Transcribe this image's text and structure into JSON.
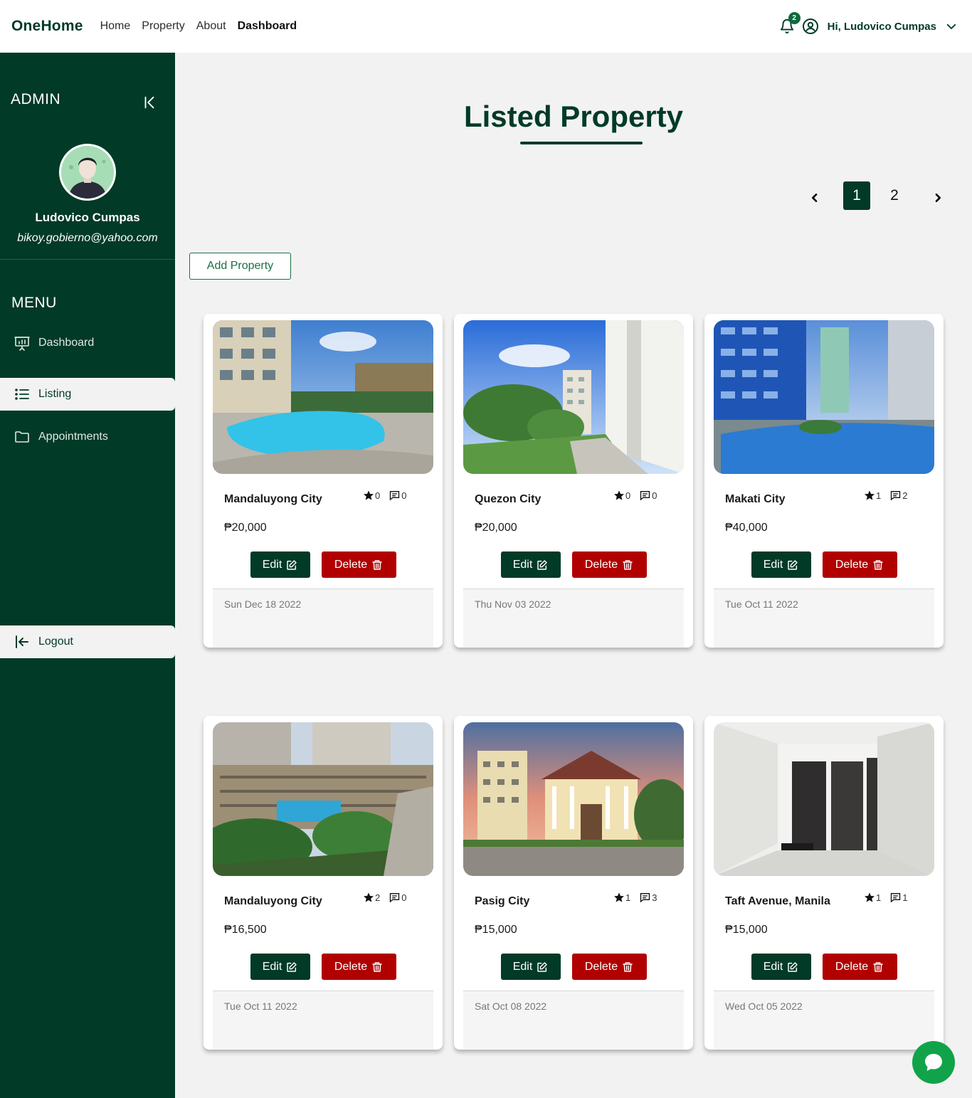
{
  "nav": {
    "brand": "OneHome",
    "links": [
      "Home",
      "Property",
      "About",
      "Dashboard"
    ],
    "notification_count": "2",
    "greeting": "Hi, Ludovico Cumpas"
  },
  "sidebar": {
    "admin_label": "ADMIN",
    "profile_name": "Ludovico Cumpas",
    "profile_email": "bikoy.gobierno@yahoo.com",
    "menu_label": "MENU",
    "items": [
      {
        "label": "Dashboard",
        "icon": "presentation-chart-icon"
      },
      {
        "label": "Listing",
        "icon": "list-icon",
        "active": true
      },
      {
        "label": "Appointments",
        "icon": "folder-icon"
      }
    ],
    "logout_label": "Logout"
  },
  "main": {
    "title": "Listed Property",
    "pages": [
      "1",
      "2"
    ],
    "current_page": "1",
    "add_button": "Add Property",
    "edit_label": "Edit",
    "delete_label": "Delete"
  },
  "cards": [
    {
      "city": "Mandaluyong City",
      "stars": "0",
      "comments": "0",
      "price": "₱20,000",
      "date": "Sun Dec 18 2022"
    },
    {
      "city": "Quezon City",
      "stars": "0",
      "comments": "0",
      "price": "₱20,000",
      "date": "Thu Nov 03 2022"
    },
    {
      "city": "Makati City",
      "stars": "1",
      "comments": "2",
      "price": "₱40,000",
      "date": "Tue Oct 11 2022"
    },
    {
      "city": "Mandaluyong City",
      "stars": "2",
      "comments": "0",
      "price": "₱16,500",
      "date": "Tue Oct 11 2022"
    },
    {
      "city": "Pasig City",
      "stars": "1",
      "comments": "3",
      "price": "₱15,000",
      "date": "Sat Oct 08 2022"
    },
    {
      "city": "Taft Avenue, Manila",
      "stars": "1",
      "comments": "1",
      "price": "₱15,000",
      "date": "Wed Oct 05 2022"
    }
  ],
  "colors": {
    "brand_green": "#013a27",
    "delete_red": "#b10000",
    "chat_green": "#11a34a"
  }
}
